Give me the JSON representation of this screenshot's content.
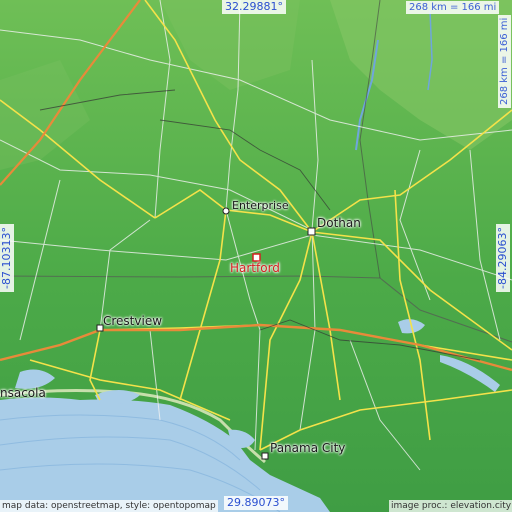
{
  "map": {
    "highlighted_city": "Hartford",
    "cities": {
      "enterprise": "Enterprise",
      "dothan": "Dothan",
      "crestview": "Crestview",
      "pensacola": "nsacola",
      "panama_city": "Panama City"
    },
    "coordinates": {
      "north": "32.29881°",
      "south": "29.89073°",
      "west": "-87.10313°",
      "east": "-84.29063°"
    },
    "scale": {
      "horizontal": "268 km = 166 mi",
      "vertical": "268 km = 166 mi"
    },
    "credits": {
      "left": "map data: openstreetmap, style: opentopomap",
      "right": "image proc.: elevation.city"
    },
    "colors": {
      "land": "#4fae4a",
      "water": "#a8c8e8",
      "highlight": "#d42020",
      "coord_text": "#2a4fd0"
    }
  }
}
